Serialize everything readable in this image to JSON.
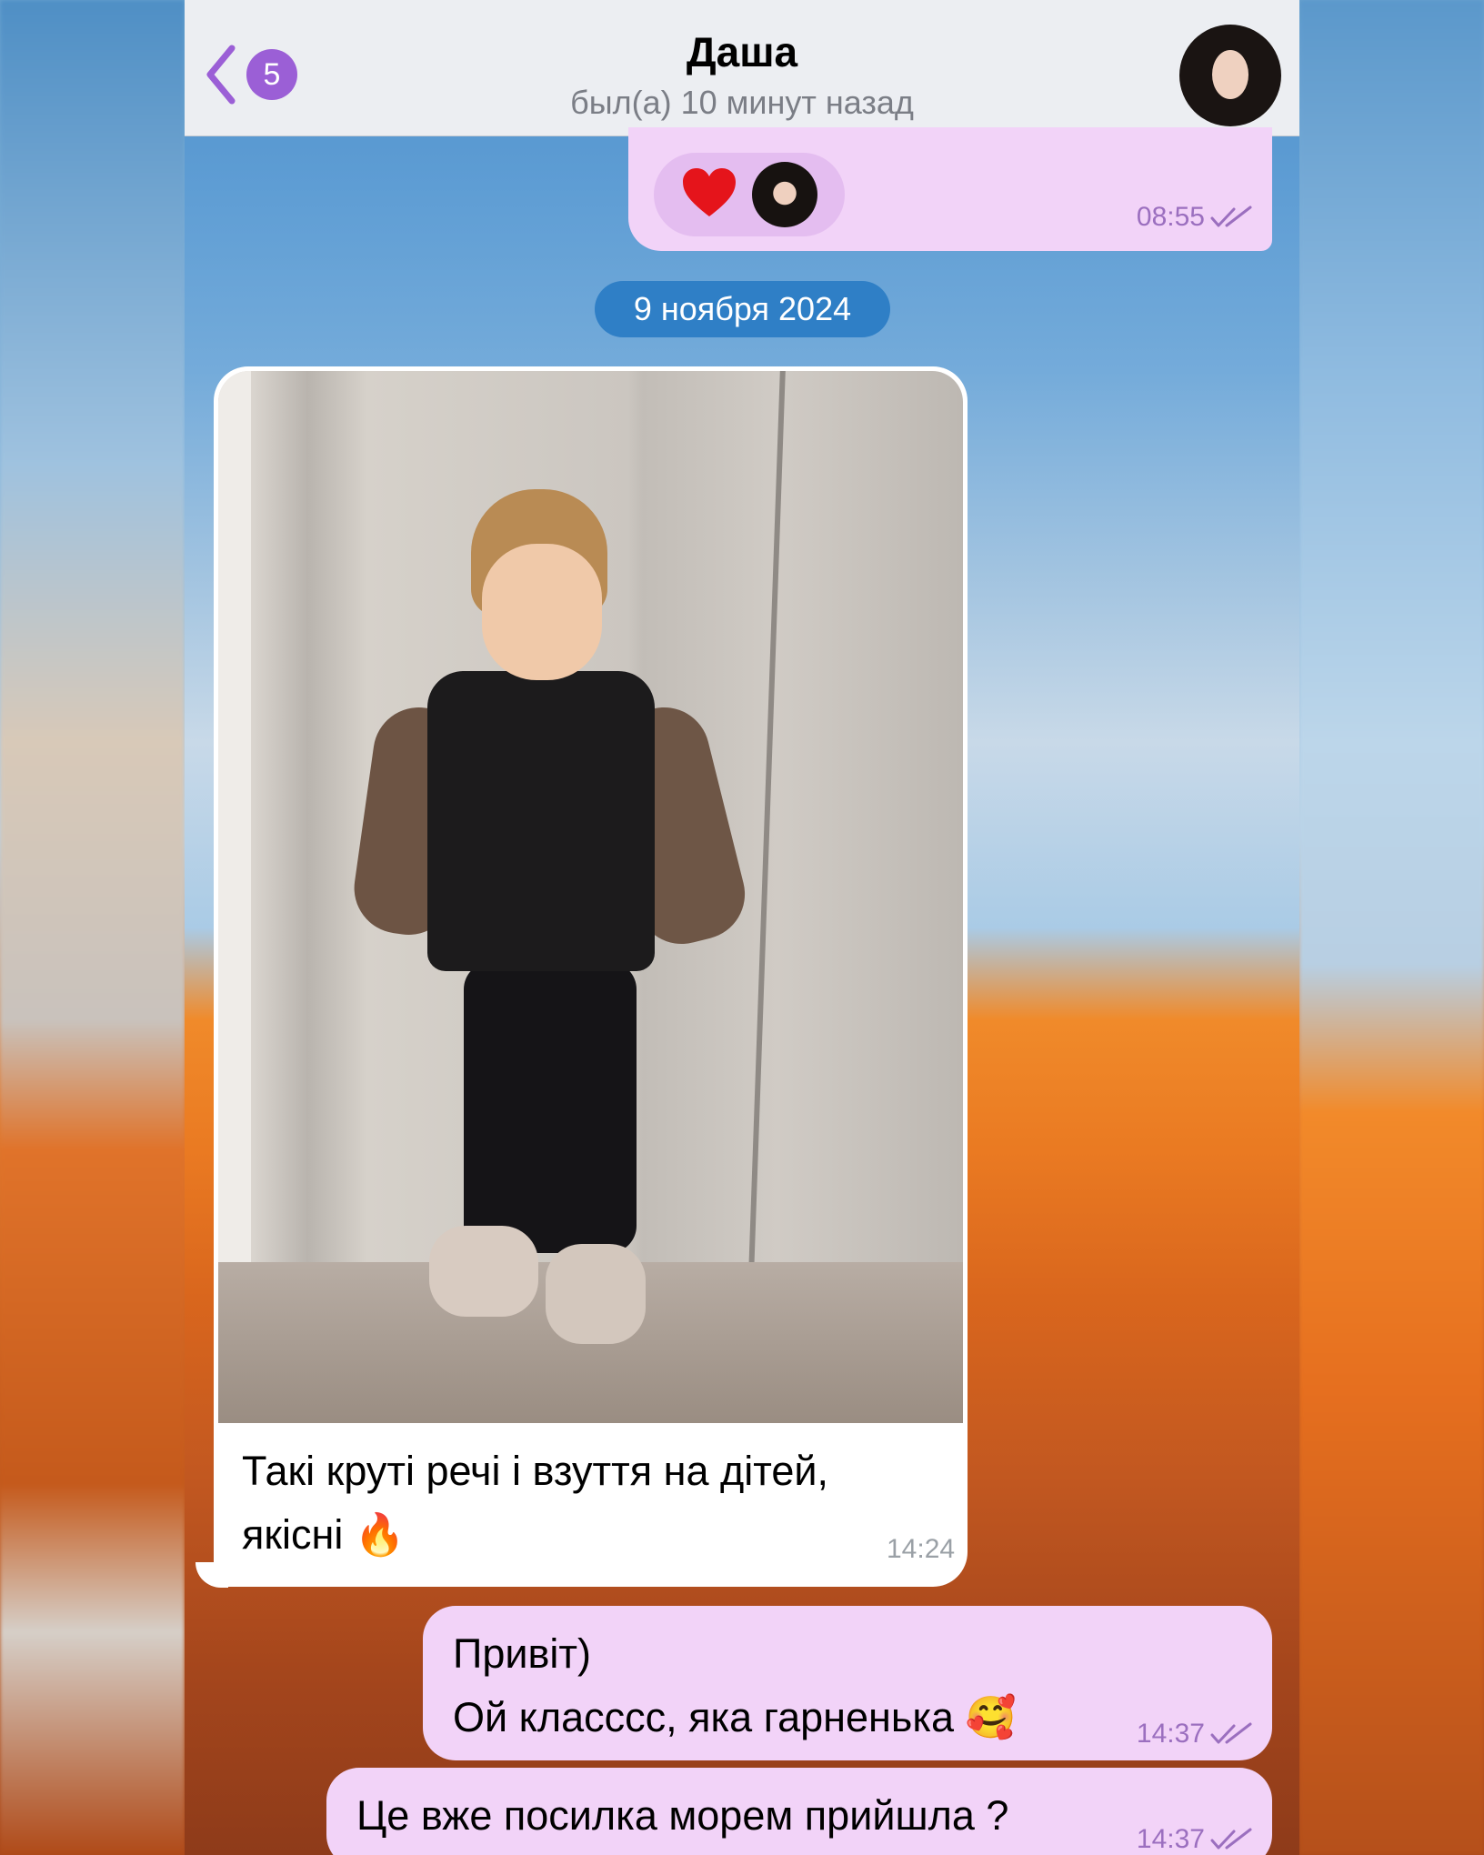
{
  "header": {
    "back_badge": "5",
    "contact_name": "Даша",
    "contact_status": "был(а) 10 минут назад",
    "back_icon": "chevron-left-icon",
    "avatar_icon": "contact-avatar"
  },
  "messages": {
    "reaction": {
      "emoji": "heart-icon",
      "time": "08:55",
      "status": "read"
    },
    "date_separator": "9 ноября 2024",
    "incoming_photo": {
      "caption_line1": "Такі круті речі і взуття на дітей,",
      "caption_line2": "якісні 🔥",
      "time": "14:24"
    },
    "outgoing_1": {
      "line1": "Привіт)",
      "line2": "Ой класссс, яка гарненька 🥰",
      "time": "14:37",
      "status": "read"
    },
    "outgoing_2": {
      "text": "Це вже посилка морем прийшла ?",
      "time": "14:37",
      "status": "read"
    }
  },
  "colors": {
    "accent": "#9b5fd6",
    "outgoing_bubble": "#f2d3f8",
    "date_pill": "#2f7fc6",
    "heart": "#e5141b"
  }
}
